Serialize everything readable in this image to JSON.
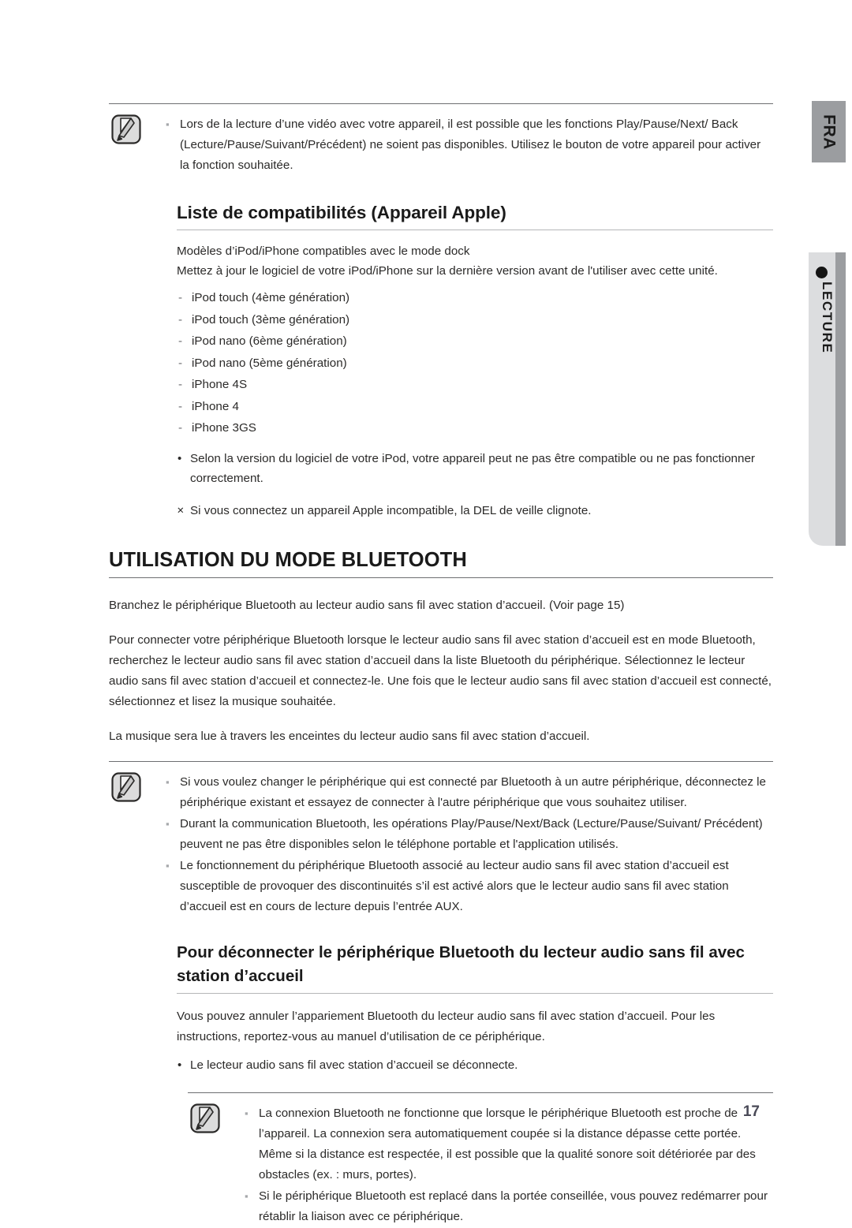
{
  "sidebar": {
    "language_tab": "FRA",
    "section_tab": "LECTURE",
    "bullet_icon": "filled-circle-icon"
  },
  "page_number": "17",
  "note_icon_name": "note-pencil-icon",
  "notes": {
    "top": {
      "items": [
        "Lors de la lecture d’une vidéo avec votre appareil, il est possible que les fonctions Play/Pause/Next/ Back (Lecture/Pause/Suivant/Précédent) ne soient pas disponibles. Utilisez le bouton de votre appareil pour activer la fonction souhaitée."
      ]
    },
    "bluetooth": {
      "items": [
        "Si vous voulez changer le périphérique qui est connecté par Bluetooth à un autre périphérique, déconnectez le périphérique existant et essayez de connecter à l'autre périphérique que vous souhaitez utiliser.",
        "Durant la communication Bluetooth, les opérations Play/Pause/Next/Back (Lecture/Pause/Suivant/ Précédent) peuvent ne pas être disponibles selon le téléphone portable et l'application utilisés.",
        "Le fonctionnement du périphérique Bluetooth associé au lecteur audio sans fil avec station d’accueil est susceptible de provoquer des discontinuités s’il est activé alors que le lecteur audio sans fil avec station d’accueil est en cours de lecture depuis l’entrée AUX."
      ]
    },
    "disconnect": {
      "items": [
        "La connexion Bluetooth ne fonctionne que lorsque le périphérique Bluetooth est proche de l’appareil. La connexion sera automatiquement coupée si la distance dépasse cette portée. Même si la distance est respectée, il est possible que la qualité sonore soit détériorée par des obstacles (ex. : murs, portes).",
        "Si le périphérique Bluetooth est replacé dans la portée conseillée, vous pouvez redémarrer pour rétablir la liaison avec ce périphérique."
      ]
    }
  },
  "compatibility": {
    "heading": "Liste de compatibilités (Appareil Apple)",
    "intro_line_1": "Modèles d’iPod/iPhone compatibles avec le mode dock",
    "intro_line_2": "Mettez à jour le logiciel de votre iPod/iPhone sur la dernière version avant de l'utiliser avec cette unité.",
    "devices": [
      "iPod touch (4ème génération)",
      "iPod touch (3ème génération)",
      "iPod nano (6ème génération)",
      "iPod nano (5ème génération)",
      "iPhone 4S",
      "iPhone 4",
      "iPhone 3GS"
    ],
    "bullet_note": "Selon la version du logiciel de votre iPod, votre appareil peut ne pas être compatible ou ne pas fonctionner correctement.",
    "x_note": "Si vous connectez un appareil Apple incompatible, la DEL de veille clignote."
  },
  "bluetooth_section": {
    "title": "UTILISATION DU MODE BLUETOOTH",
    "paragraph_1": "Branchez le périphérique Bluetooth au lecteur audio sans fil avec station d’accueil. (Voir page 15)",
    "paragraph_2": "Pour connecter votre périphérique Bluetooth lorsque le lecteur audio sans fil avec station d’accueil est en mode Bluetooth, recherchez le lecteur audio sans fil avec station d’accueil dans la liste Bluetooth du périphérique. Sélectionnez le lecteur audio sans fil avec station d’accueil et connectez-le. Une fois que le lecteur audio sans fil avec station d’accueil est connecté, sélectionnez et lisez la musique souhaitée.",
    "paragraph_3": "La musique sera lue à travers les enceintes du lecteur audio sans fil avec station d’accueil."
  },
  "disconnect_section": {
    "heading": "Pour déconnecter le périphérique Bluetooth du lecteur audio sans fil avec station d’accueil",
    "paragraph": "Vous pouvez annuler l’appariement Bluetooth du lecteur audio sans fil avec station d’accueil. Pour les instructions, reportez-vous au manuel d’utilisation de ce périphérique.",
    "bullet": "Le lecteur audio sans fil avec station d’accueil se déconnecte."
  }
}
